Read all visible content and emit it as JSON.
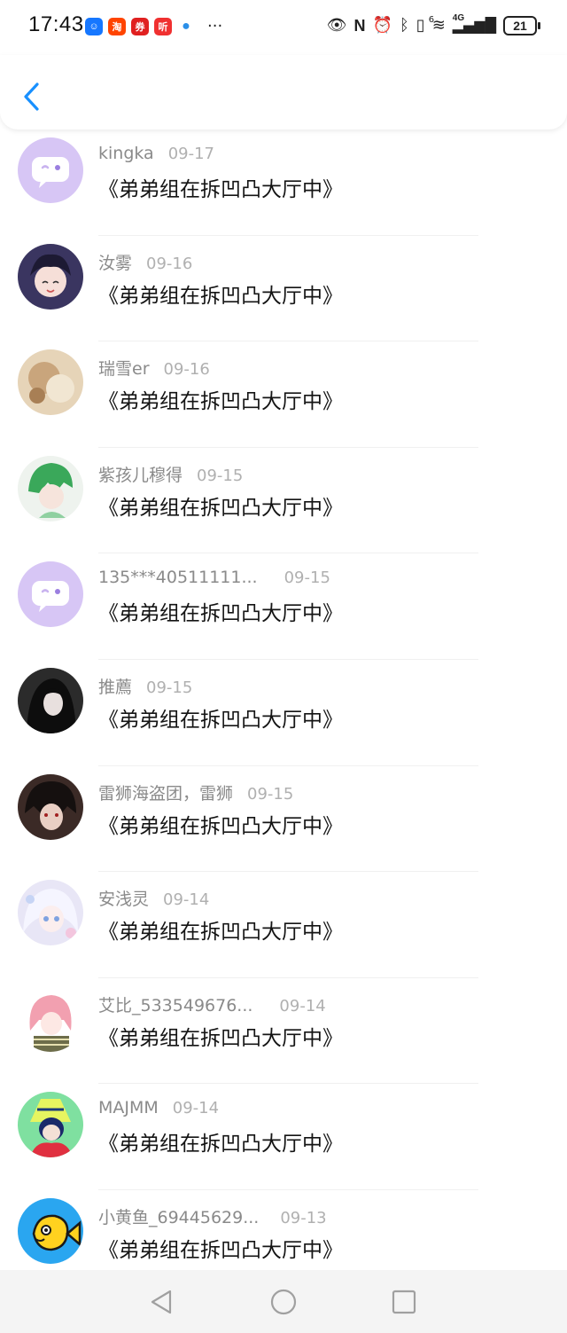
{
  "status_bar": {
    "time": "17:43",
    "app_icons": [
      {
        "name": "app-blue-icon",
        "glyph": "☺",
        "color": "#1677ff"
      },
      {
        "name": "taobao-icon",
        "glyph": "淘",
        "color": "#ff4400"
      },
      {
        "name": "red-app-icon",
        "glyph": "券",
        "color": "#e02020"
      },
      {
        "name": "listen-app-icon",
        "glyph": "听",
        "color": "#f03030"
      },
      {
        "name": "ball-app-icon",
        "glyph": "●",
        "color": "#2b8fe8"
      }
    ],
    "more": "···",
    "wifi_superscript": "6",
    "network": "4G",
    "battery": "21"
  },
  "messages": [
    {
      "name": "kingka",
      "date": "09-17",
      "text": "《弟弟组在拆凹凸大厅中》",
      "avatar": "default"
    },
    {
      "name": "汝雾",
      "date": "09-16",
      "text": "《弟弟组在拆凹凸大厅中》",
      "avatar": "dark"
    },
    {
      "name": "瑞雪er",
      "date": "09-16",
      "text": "《弟弟组在拆凹凸大厅中》",
      "avatar": "beige"
    },
    {
      "name": "紫孩儿穆得",
      "date": "09-15",
      "text": "《弟弟组在拆凹凸大厅中》",
      "avatar": "green"
    },
    {
      "name": "135***40511111...",
      "date": "09-15",
      "text": "《弟弟组在拆凹凸大厅中》",
      "avatar": "default"
    },
    {
      "name": "推薦",
      "date": "09-15",
      "text": "《弟弟组在拆凹凸大厅中》",
      "avatar": "black"
    },
    {
      "name": "雷狮海盗团，雷狮",
      "date": "09-15",
      "text": "《弟弟组在拆凹凸大厅中》",
      "avatar": "darkred"
    },
    {
      "name": "安浅灵",
      "date": "09-14",
      "text": "《弟弟组在拆凹凸大厅中》",
      "avatar": "lilac"
    },
    {
      "name": "艾比_533549676...",
      "date": "09-14",
      "text": "《弟弟组在拆凹凸大厅中》",
      "avatar": "pink"
    },
    {
      "name": "MAJMM",
      "date": "09-14",
      "text": "《弟弟组在拆凹凸大厅中》",
      "avatar": "teal"
    },
    {
      "name": "小黄鱼_69445629...",
      "date": "09-13",
      "text": "《弟弟组在拆凹凸大厅中》",
      "avatar": "fish"
    }
  ]
}
